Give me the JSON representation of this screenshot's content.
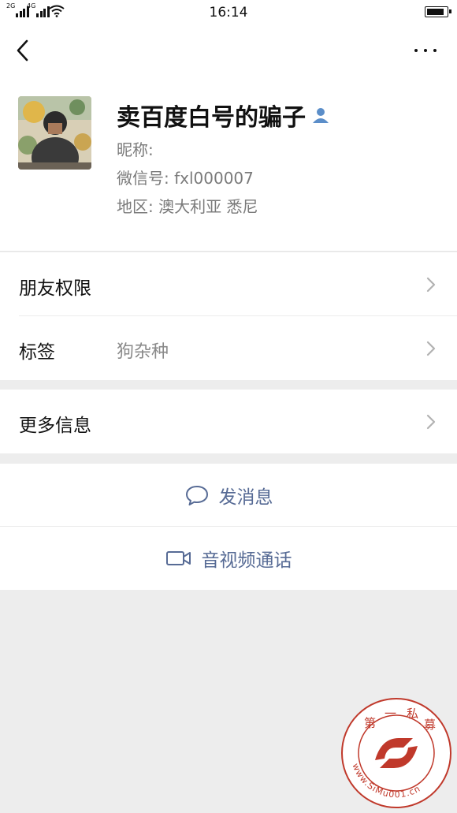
{
  "status_bar": {
    "network_1": "2G",
    "network_2": "4G",
    "time": "16:14"
  },
  "profile": {
    "display_name": "卖百度白号的骗子",
    "nickname": "昵称:",
    "wechat_id": "微信号: fxl000007",
    "region": "地区: 澳大利亚  悉尼"
  },
  "rows": {
    "friend_permissions": "朋友权限",
    "tags_label": "标签",
    "tags_value": "狗杂种",
    "more_info": "更多信息"
  },
  "actions": {
    "send_message": "发消息",
    "video_call": "音视频通话"
  },
  "watermark": {
    "chars": [
      "第",
      "一",
      "私",
      "募"
    ],
    "url": "www.SiMu001.cn"
  },
  "colors": {
    "link_blue": "#576b95",
    "badge_blue": "#5b8ec9",
    "watermark_red": "#c0392b"
  }
}
